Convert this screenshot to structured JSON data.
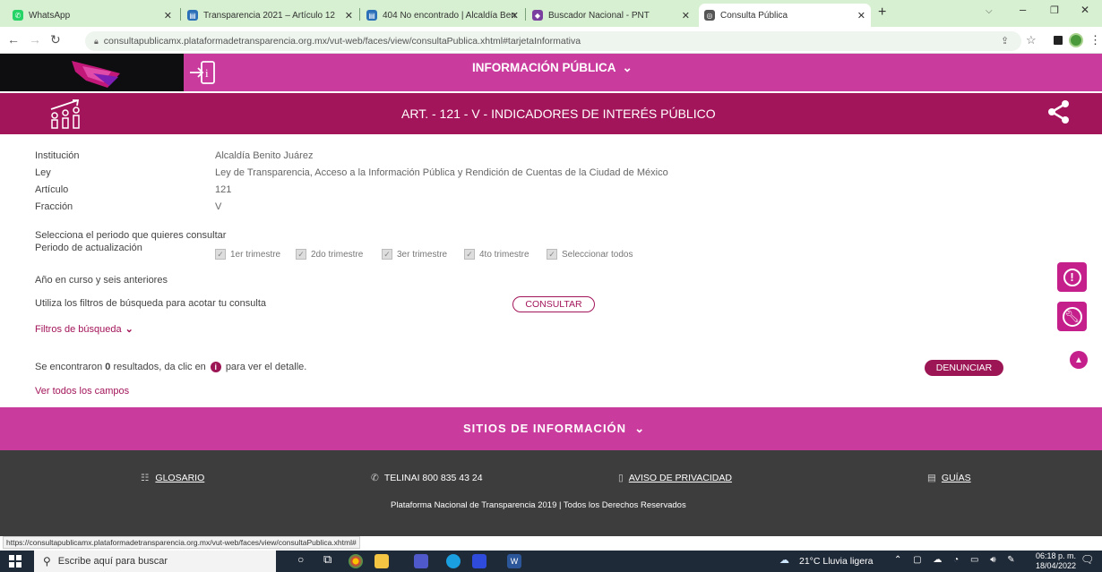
{
  "browser": {
    "tabs": [
      {
        "title": "WhatsApp",
        "color": "#25d366"
      },
      {
        "title": "Transparencia 2021 – Artículo 12",
        "color": "#2a6fb8"
      },
      {
        "title": "404 No encontrado | Alcaldía Ben",
        "color": "#2a6fb8"
      },
      {
        "title": "Buscador Nacional - PNT",
        "color": "#7b3fa0"
      },
      {
        "title": "Consulta Pública",
        "color": "#555555"
      }
    ],
    "new_tab": "+",
    "url": "consultapublicamx.plataformadetransparencia.org.mx/vut-web/faces/view/consultaPublica.xhtml#tarjetaInformativa"
  },
  "header": {
    "menu_label": "INFORMACIÓN PÚBLICA",
    "article_title": "ART. - 121 - V - INDICADORES DE INTERÉS PÚBLICO"
  },
  "info": {
    "fields": [
      {
        "label": "Institución",
        "value": "Alcaldía Benito Juárez"
      },
      {
        "label": "Ley",
        "value": "Ley de Transparencia, Acceso a la Información Pública y Rendición de Cuentas de la Ciudad de México"
      },
      {
        "label": "Artículo",
        "value": "121"
      },
      {
        "label": "Fracción",
        "value": "V"
      }
    ]
  },
  "period": {
    "prompt": "Selecciona el periodo que quieres consultar",
    "label": "Periodo de actualización",
    "options": [
      "1er trimestre",
      "2do trimestre",
      "3er trimestre",
      "4to trimestre",
      "Seleccionar todos"
    ],
    "years_note": "Año en curso y seis anteriores"
  },
  "search": {
    "hint": "Utiliza los filtros de búsqueda para acotar tu consulta",
    "consult_button": "CONSULTAR",
    "filters_label": "Filtros de búsqueda"
  },
  "results": {
    "prefix": "Se encontraron",
    "count": "0",
    "suffix_a": "resultados, da clic en",
    "suffix_b": "para ver el detalle.",
    "report_button": "DENUNCIAR",
    "all_fields_link": "Ver todos los campos"
  },
  "footer": {
    "sites_label": "SITIOS DE INFORMACIÓN",
    "glossary": "GLOSARIO",
    "phone": "TELINAI 800 835 43 24",
    "privacy": "AVISO DE PRIVACIDAD",
    "guides": "GUÍAS",
    "copyright": "Plataforma Nacional de Transparencia 2019 | Todos los Derechos Reservados"
  },
  "status_url": "https://consultapublicamx.plataformadetransparencia.org.mx/vut-web/faces/view/consultaPublica.xhtml#",
  "taskbar": {
    "search_placeholder": "Escribe aquí para buscar",
    "weather": "21°C  Lluvia ligera",
    "time": "06:18 p. m.",
    "date": "18/04/2022"
  },
  "colors": {
    "magenta": "#c93c9e",
    "crimson": "#a3155a",
    "button_crimson": "#9c1554",
    "footer_gray": "#3d3d3d"
  }
}
